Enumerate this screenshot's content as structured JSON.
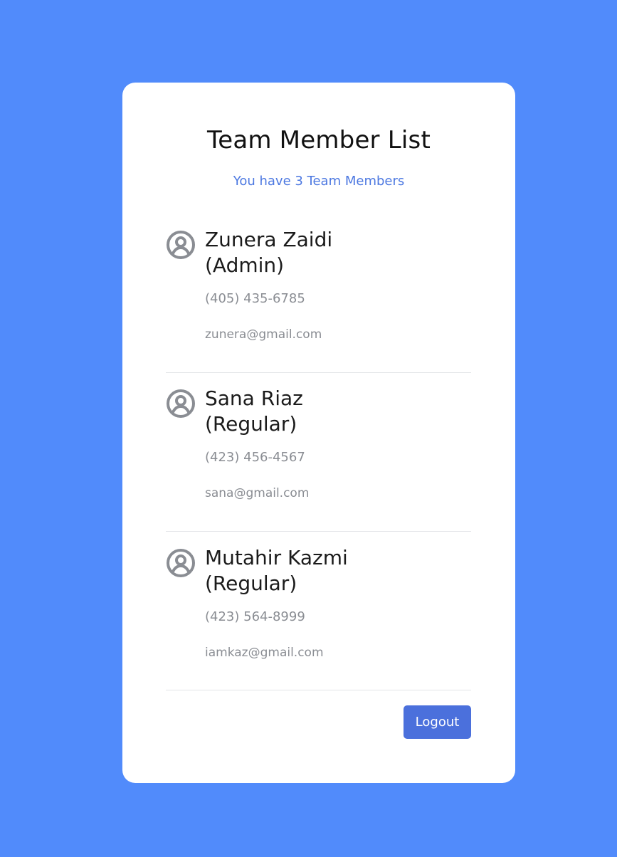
{
  "card": {
    "title": "Team Member List",
    "subtitle": "You have 3 Team Members"
  },
  "members": [
    {
      "name": "Zunera Zaidi",
      "role": "(Admin)",
      "phone": "(405) 435-6785",
      "email": "zunera@gmail.com",
      "icon": "user-circle-icon"
    },
    {
      "name": "Sana Riaz",
      "role": "(Regular)",
      "phone": "(423) 456-4567",
      "email": "sana@gmail.com",
      "icon": "user-circle-icon"
    },
    {
      "name": "Mutahir Kazmi",
      "role": "(Regular)",
      "phone": "(423) 564-8999",
      "email": "iamkaz@gmail.com",
      "icon": "user-circle-icon"
    }
  ],
  "actions": {
    "logout_label": "Logout"
  },
  "colors": {
    "background": "#518bfb",
    "card": "#ffffff",
    "accent": "#4b70dc",
    "subtitle": "#4c78e1",
    "muted_text": "#8a8d93",
    "icon": "#8a8d93"
  }
}
